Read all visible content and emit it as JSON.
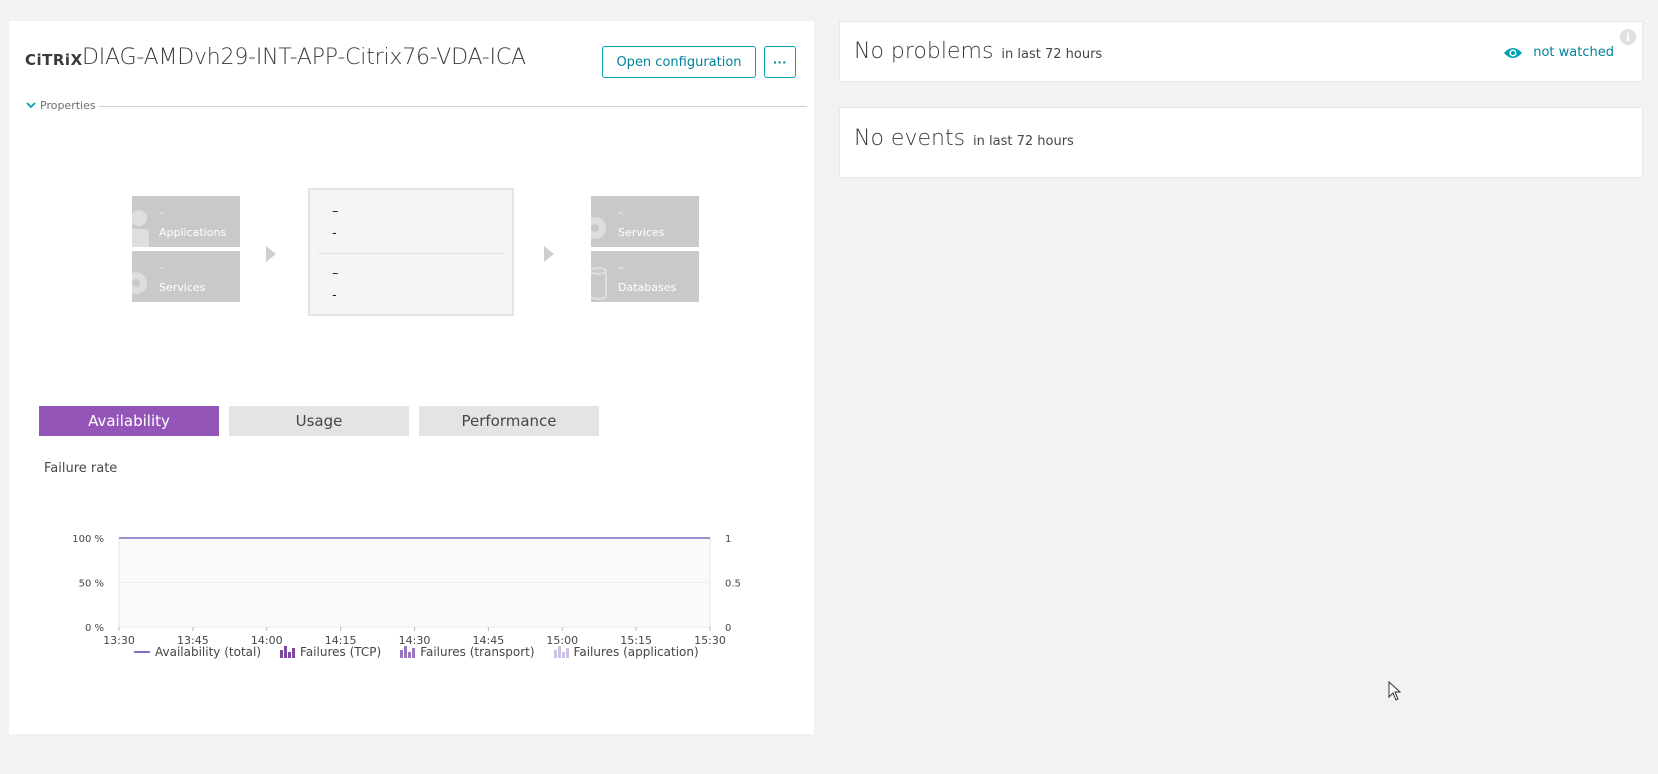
{
  "header": {
    "brand": "CiTRiX",
    "title": "DIAG-AMDvh29-INT-APP-Citrix76-VDA-ICA",
    "open_config_label": "Open configuration",
    "more_label": "···"
  },
  "properties": {
    "label": "Properties"
  },
  "flow": {
    "left_top": {
      "count": "–",
      "label": "Applications",
      "icon": "user-icon"
    },
    "left_bottom": {
      "count": "–",
      "label": "Services",
      "icon": "gear-icon"
    },
    "center": {
      "values": [
        "–",
        "-",
        "–",
        "-"
      ]
    },
    "right_top": {
      "count": "–",
      "label": "Services",
      "icon": "gear-icon"
    },
    "right_bottom": {
      "count": "–",
      "label": "Databases",
      "icon": "database-icon"
    }
  },
  "tabs": [
    {
      "label": "Availability",
      "active": true
    },
    {
      "label": "Usage",
      "active": false
    },
    {
      "label": "Performance",
      "active": false
    }
  ],
  "chart_section": {
    "title": "Failure rate"
  },
  "chart_data": {
    "type": "line",
    "title": "Failure rate",
    "x": [
      "13:30",
      "13:45",
      "14:00",
      "14:15",
      "14:30",
      "14:45",
      "15:00",
      "15:15",
      "15:30"
    ],
    "y_left_ticks": [
      "100 %",
      "50 %",
      "0 %"
    ],
    "y_right_ticks": [
      "1",
      "0.5",
      "0"
    ],
    "ylim_left": [
      0,
      100
    ],
    "ylim_right": [
      0,
      1
    ],
    "series": [
      {
        "name": "Availability (total)",
        "type": "line",
        "values": [
          100,
          100,
          100,
          100,
          100,
          100,
          100,
          100,
          100
        ]
      },
      {
        "name": "Failures (TCP)",
        "type": "bar",
        "values": []
      },
      {
        "name": "Failures (transport)",
        "type": "bar",
        "values": []
      },
      {
        "name": "Failures (application)",
        "type": "bar",
        "values": []
      }
    ],
    "grid": true,
    "legend_position": "bottom"
  },
  "legend": [
    {
      "label": "Availability (total)",
      "color": "#7c6fc6",
      "kind": "line"
    },
    {
      "label": "Failures (TCP)",
      "color": "#7c4a9e",
      "kind": "bars"
    },
    {
      "label": "Failures (transport)",
      "color": "#9b77c0",
      "kind": "bars"
    },
    {
      "label": "Failures (application)",
      "color": "#cfc3e3",
      "kind": "bars"
    }
  ],
  "problems": {
    "title": "No problems",
    "subtitle": "in last 72 hours",
    "watch_label": "not watched",
    "info": "i"
  },
  "events": {
    "title": "No events",
    "subtitle": "in last 72 hours"
  },
  "colors": {
    "accent": "#00a1b2",
    "purple": "#9355b7",
    "tile": "#c9c9c9"
  }
}
